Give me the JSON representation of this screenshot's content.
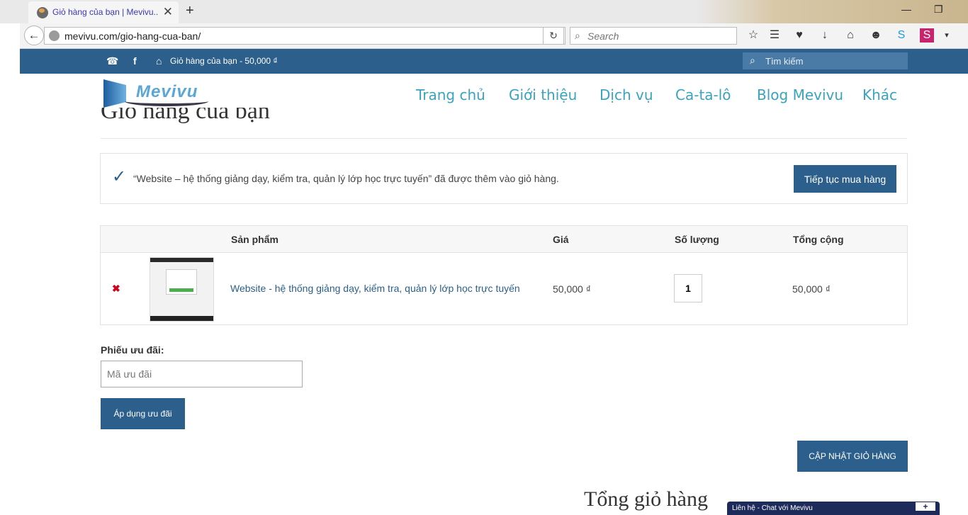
{
  "browser": {
    "tab_title": "Giỏ hàng của bạn | Mevivu...",
    "url": "mevivu.com/gio-hang-cua-ban/",
    "search_placeholder": "Search"
  },
  "topbar": {
    "cart_summary": "Giỏ hàng của bạn - 50,000 ₫",
    "search_placeholder": "Tìm kiếm"
  },
  "header": {
    "logo_text": "Mevivu",
    "nav": [
      "Trang chủ",
      "Giới thiệu",
      "Dịch vụ",
      "Ca-ta-lô",
      "Blog Mevivu",
      "Khác"
    ]
  },
  "page": {
    "title": "Giỏ hàng của bạn"
  },
  "notice": {
    "message": "“Website – hệ thống giảng dạy, kiểm tra, quản lý lớp học trực tuyến” đã được thêm vào giỏ hàng.",
    "continue_label": "Tiếp tục mua hàng"
  },
  "cart": {
    "columns": [
      "Sản phẩm",
      "Giá",
      "Số lượng",
      "Tổng cộng"
    ],
    "items": [
      {
        "remove": "✖",
        "name": "Website - hệ thống giảng dạy, kiểm tra, quản lý lớp học trực tuyến",
        "price": "50,000 ₫",
        "quantity": "1",
        "subtotal": "50,000 ₫"
      }
    ]
  },
  "coupon": {
    "label": "Phiếu ưu đãi:",
    "placeholder": "Mã ưu đãi",
    "apply_label": "Áp dụng ưu đãi"
  },
  "update_label": "CẬP NHẬT GIỎ HÀNG",
  "totals_title": "Tổng giỏ hàng",
  "chat": {
    "label": "Liên hệ - Chat với Mevivu",
    "plus": "+"
  },
  "colors": {
    "primary": "#2c5f8c",
    "nav_text": "#3aa3c0",
    "remove": "#d0021b",
    "chat_bar": "#1d2b5a"
  }
}
